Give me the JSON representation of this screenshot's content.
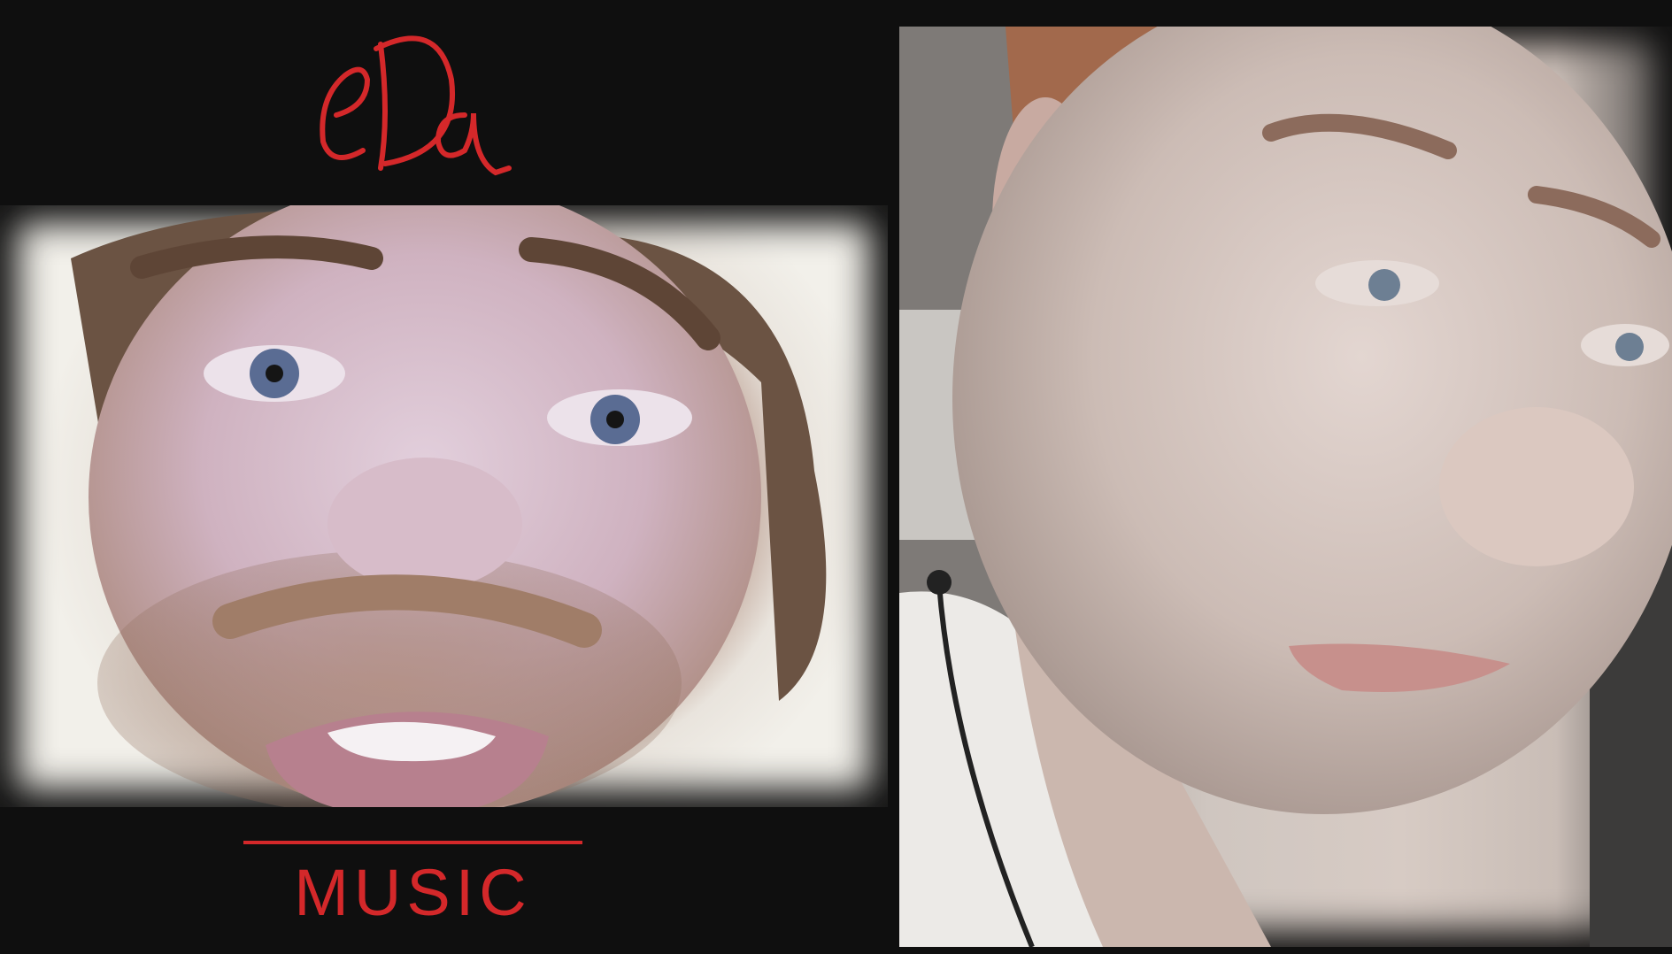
{
  "brand": {
    "logo_text": "eDa",
    "subtitle": "MUSIC",
    "accent_color": "#d4282a",
    "background_color": "#0f0f0f"
  },
  "panels": [
    {
      "label": "left-video-frame"
    },
    {
      "label": "right-video-frame"
    }
  ]
}
